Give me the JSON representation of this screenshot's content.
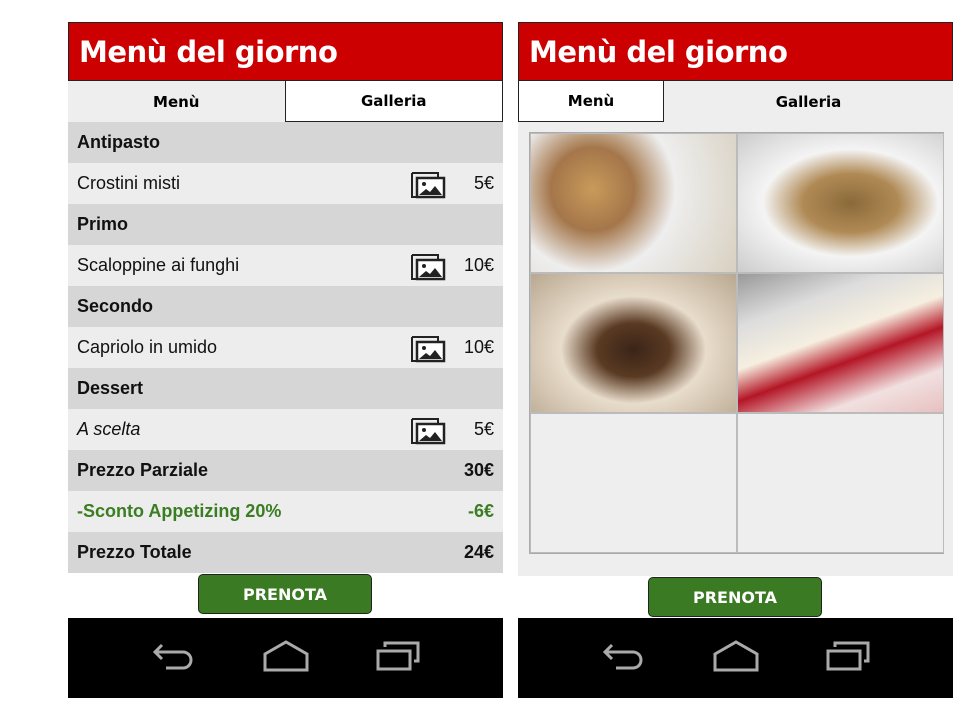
{
  "title": "Menù del giorno",
  "tabs": {
    "menu": "Menù",
    "gallery": "Galleria"
  },
  "menu": [
    {
      "type": "cat",
      "label": "Antipasto"
    },
    {
      "type": "item",
      "label": "Crostini misti",
      "price": "5€",
      "icon": "image-icon"
    },
    {
      "type": "cat",
      "label": "Primo"
    },
    {
      "type": "item",
      "label": "Scaloppine ai funghi",
      "price": "10€",
      "icon": "image-icon"
    },
    {
      "type": "cat",
      "label": "Secondo"
    },
    {
      "type": "item",
      "label": "Capriolo in umido",
      "price": "10€",
      "icon": "image-icon"
    },
    {
      "type": "cat",
      "label": "Dessert"
    },
    {
      "type": "item",
      "label": "A scelta",
      "price": "5€",
      "icon": "image-icon"
    }
  ],
  "totals": {
    "partial_label": "Prezzo Parziale",
    "partial": "30€",
    "discount_label": "-Sconto Appetizing 20%",
    "discount": "-6€",
    "total_label": "Prezzo Totale",
    "total": "24€"
  },
  "button": "PRENOTA",
  "colors": {
    "header": "#cc0000",
    "button": "#3a7a22",
    "discount": "#3a7d22"
  }
}
